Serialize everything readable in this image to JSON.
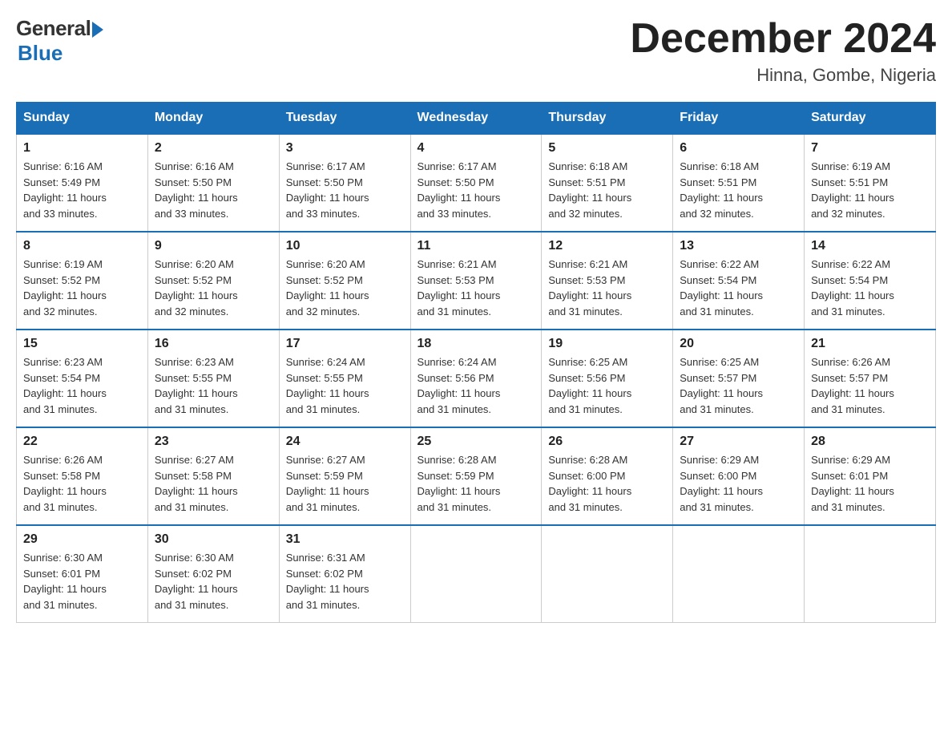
{
  "logo": {
    "general": "General",
    "blue": "Blue"
  },
  "title": "December 2024",
  "location": "Hinna, Gombe, Nigeria",
  "days_of_week": [
    "Sunday",
    "Monday",
    "Tuesday",
    "Wednesday",
    "Thursday",
    "Friday",
    "Saturday"
  ],
  "weeks": [
    [
      {
        "num": "1",
        "sunrise": "6:16 AM",
        "sunset": "5:49 PM",
        "daylight": "11 hours and 33 minutes."
      },
      {
        "num": "2",
        "sunrise": "6:16 AM",
        "sunset": "5:50 PM",
        "daylight": "11 hours and 33 minutes."
      },
      {
        "num": "3",
        "sunrise": "6:17 AM",
        "sunset": "5:50 PM",
        "daylight": "11 hours and 33 minutes."
      },
      {
        "num": "4",
        "sunrise": "6:17 AM",
        "sunset": "5:50 PM",
        "daylight": "11 hours and 33 minutes."
      },
      {
        "num": "5",
        "sunrise": "6:18 AM",
        "sunset": "5:51 PM",
        "daylight": "11 hours and 32 minutes."
      },
      {
        "num": "6",
        "sunrise": "6:18 AM",
        "sunset": "5:51 PM",
        "daylight": "11 hours and 32 minutes."
      },
      {
        "num": "7",
        "sunrise": "6:19 AM",
        "sunset": "5:51 PM",
        "daylight": "11 hours and 32 minutes."
      }
    ],
    [
      {
        "num": "8",
        "sunrise": "6:19 AM",
        "sunset": "5:52 PM",
        "daylight": "11 hours and 32 minutes."
      },
      {
        "num": "9",
        "sunrise": "6:20 AM",
        "sunset": "5:52 PM",
        "daylight": "11 hours and 32 minutes."
      },
      {
        "num": "10",
        "sunrise": "6:20 AM",
        "sunset": "5:52 PM",
        "daylight": "11 hours and 32 minutes."
      },
      {
        "num": "11",
        "sunrise": "6:21 AM",
        "sunset": "5:53 PM",
        "daylight": "11 hours and 31 minutes."
      },
      {
        "num": "12",
        "sunrise": "6:21 AM",
        "sunset": "5:53 PM",
        "daylight": "11 hours and 31 minutes."
      },
      {
        "num": "13",
        "sunrise": "6:22 AM",
        "sunset": "5:54 PM",
        "daylight": "11 hours and 31 minutes."
      },
      {
        "num": "14",
        "sunrise": "6:22 AM",
        "sunset": "5:54 PM",
        "daylight": "11 hours and 31 minutes."
      }
    ],
    [
      {
        "num": "15",
        "sunrise": "6:23 AM",
        "sunset": "5:54 PM",
        "daylight": "11 hours and 31 minutes."
      },
      {
        "num": "16",
        "sunrise": "6:23 AM",
        "sunset": "5:55 PM",
        "daylight": "11 hours and 31 minutes."
      },
      {
        "num": "17",
        "sunrise": "6:24 AM",
        "sunset": "5:55 PM",
        "daylight": "11 hours and 31 minutes."
      },
      {
        "num": "18",
        "sunrise": "6:24 AM",
        "sunset": "5:56 PM",
        "daylight": "11 hours and 31 minutes."
      },
      {
        "num": "19",
        "sunrise": "6:25 AM",
        "sunset": "5:56 PM",
        "daylight": "11 hours and 31 minutes."
      },
      {
        "num": "20",
        "sunrise": "6:25 AM",
        "sunset": "5:57 PM",
        "daylight": "11 hours and 31 minutes."
      },
      {
        "num": "21",
        "sunrise": "6:26 AM",
        "sunset": "5:57 PM",
        "daylight": "11 hours and 31 minutes."
      }
    ],
    [
      {
        "num": "22",
        "sunrise": "6:26 AM",
        "sunset": "5:58 PM",
        "daylight": "11 hours and 31 minutes."
      },
      {
        "num": "23",
        "sunrise": "6:27 AM",
        "sunset": "5:58 PM",
        "daylight": "11 hours and 31 minutes."
      },
      {
        "num": "24",
        "sunrise": "6:27 AM",
        "sunset": "5:59 PM",
        "daylight": "11 hours and 31 minutes."
      },
      {
        "num": "25",
        "sunrise": "6:28 AM",
        "sunset": "5:59 PM",
        "daylight": "11 hours and 31 minutes."
      },
      {
        "num": "26",
        "sunrise": "6:28 AM",
        "sunset": "6:00 PM",
        "daylight": "11 hours and 31 minutes."
      },
      {
        "num": "27",
        "sunrise": "6:29 AM",
        "sunset": "6:00 PM",
        "daylight": "11 hours and 31 minutes."
      },
      {
        "num": "28",
        "sunrise": "6:29 AM",
        "sunset": "6:01 PM",
        "daylight": "11 hours and 31 minutes."
      }
    ],
    [
      {
        "num": "29",
        "sunrise": "6:30 AM",
        "sunset": "6:01 PM",
        "daylight": "11 hours and 31 minutes."
      },
      {
        "num": "30",
        "sunrise": "6:30 AM",
        "sunset": "6:02 PM",
        "daylight": "11 hours and 31 minutes."
      },
      {
        "num": "31",
        "sunrise": "6:31 AM",
        "sunset": "6:02 PM",
        "daylight": "11 hours and 31 minutes."
      },
      null,
      null,
      null,
      null
    ]
  ],
  "labels": {
    "sunrise": "Sunrise:",
    "sunset": "Sunset:",
    "daylight": "Daylight:"
  }
}
